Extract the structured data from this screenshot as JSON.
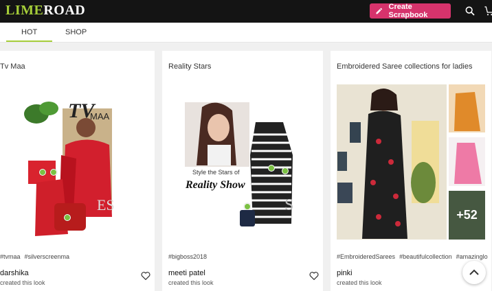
{
  "header": {
    "logo_lime": "LIME",
    "logo_road": "ROAD",
    "create_label": "Create Scrapbook",
    "icons": [
      "pencil-icon",
      "search-icon",
      "cart-icon"
    ]
  },
  "tabs": [
    {
      "label": "HOT",
      "active": true
    },
    {
      "label": "SHOP",
      "active": false
    }
  ],
  "cards": [
    {
      "title": "Tv Maa",
      "image_text_1": "TV",
      "image_text_2": "MAA",
      "tags": [
        "#tvmaa",
        "#silverscreenma"
      ],
      "author": "darshika",
      "created": "created this look"
    },
    {
      "title": "Reality Stars",
      "image_text_1": "Style the Stars of",
      "image_text_2": "Reality Show",
      "tags": [
        "#bigboss2018"
      ],
      "author": "meeti patel",
      "created": "created this look"
    },
    {
      "title": "Embroidered Saree collections for ladies",
      "more_count": "+52",
      "tags": [
        "#EmbroideredSarees",
        "#beautifulcollection",
        "#amazinglo"
      ],
      "author": "pinki",
      "created": "created this look"
    }
  ],
  "colors": {
    "brand_lime": "#a6ce39",
    "create_button": "#d6336c",
    "topbar": "#141414",
    "hotspot": "#7bc043"
  }
}
